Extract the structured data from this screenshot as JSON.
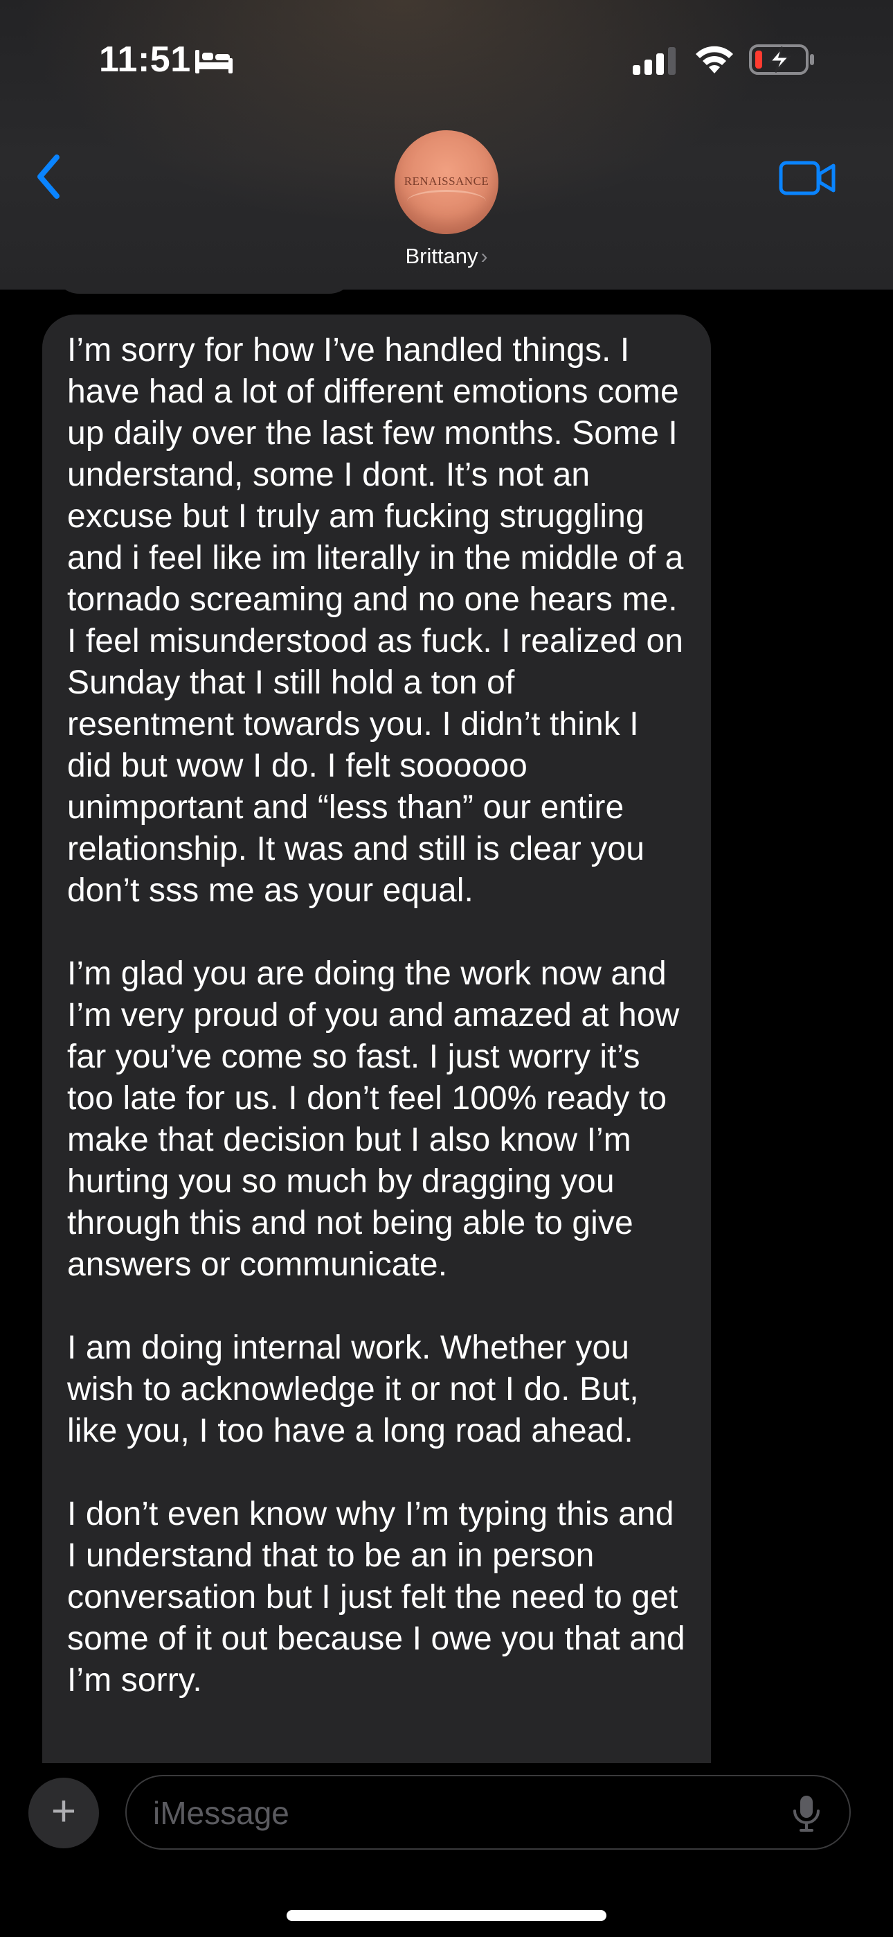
{
  "status_bar": {
    "time": "11:51",
    "focus_icon": "bed-icon",
    "signal_icon": "cellular-signal-icon",
    "wifi_icon": "wifi-icon",
    "battery_icon": "battery-charging-low-icon",
    "battery_low_color": "#ff3b30"
  },
  "header": {
    "back_icon": "chevron-left-icon",
    "contact_name": "Brittany",
    "contact_chevron": "›",
    "avatar_text": "RENAISSANCE",
    "video_icon": "video-camera-icon",
    "accent_color": "#0a84ff"
  },
  "message": {
    "paragraphs": [
      "I’m sorry for how I’ve handled things. I have had a lot of different emotions come up daily over the last few months. Some I understand, some I dont. It’s not an excuse but I truly am fucking struggling and i feel like im literally in the middle of a tornado screaming and no one hears me. I feel misunderstood as fuck. I realized on Sunday that I still hold a ton of resentment towards you. I didn’t think I did but wow I do. I felt soooooo unimportant and “less than” our entire relationship. It was and still is clear you don’t sss me as your equal.",
      "I’m glad you are doing the work now and I’m very proud of you and amazed at how far you’ve come so fast. I just worry it’s too late for us. I don’t feel 100% ready to make that decision but I also know I’m hurting you so much by dragging you through this and not being able to give answers or communicate.",
      "I am doing internal work. Whether you wish to acknowledge it or not I do. But, like you, I too have a long road ahead.",
      "I don’t even know why I’m typing this and I understand that to be an in person conversation but I just felt the need to get some of it out because I owe you that and I’m sorry."
    ],
    "bubble_color": "#262628"
  },
  "composer": {
    "plus_label": "+",
    "placeholder": "iMessage",
    "mic_icon": "microphone-icon"
  }
}
